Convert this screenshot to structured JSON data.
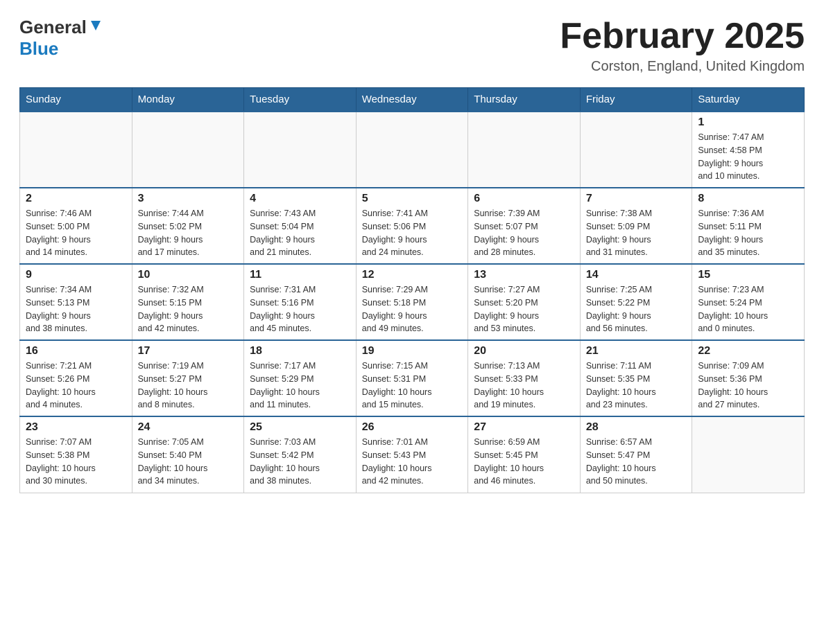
{
  "header": {
    "logo_general": "General",
    "logo_blue": "Blue",
    "month_title": "February 2025",
    "location": "Corston, England, United Kingdom"
  },
  "weekdays": [
    "Sunday",
    "Monday",
    "Tuesday",
    "Wednesday",
    "Thursday",
    "Friday",
    "Saturday"
  ],
  "weeks": [
    [
      {
        "day": "",
        "info": ""
      },
      {
        "day": "",
        "info": ""
      },
      {
        "day": "",
        "info": ""
      },
      {
        "day": "",
        "info": ""
      },
      {
        "day": "",
        "info": ""
      },
      {
        "day": "",
        "info": ""
      },
      {
        "day": "1",
        "info": "Sunrise: 7:47 AM\nSunset: 4:58 PM\nDaylight: 9 hours\nand 10 minutes."
      }
    ],
    [
      {
        "day": "2",
        "info": "Sunrise: 7:46 AM\nSunset: 5:00 PM\nDaylight: 9 hours\nand 14 minutes."
      },
      {
        "day": "3",
        "info": "Sunrise: 7:44 AM\nSunset: 5:02 PM\nDaylight: 9 hours\nand 17 minutes."
      },
      {
        "day": "4",
        "info": "Sunrise: 7:43 AM\nSunset: 5:04 PM\nDaylight: 9 hours\nand 21 minutes."
      },
      {
        "day": "5",
        "info": "Sunrise: 7:41 AM\nSunset: 5:06 PM\nDaylight: 9 hours\nand 24 minutes."
      },
      {
        "day": "6",
        "info": "Sunrise: 7:39 AM\nSunset: 5:07 PM\nDaylight: 9 hours\nand 28 minutes."
      },
      {
        "day": "7",
        "info": "Sunrise: 7:38 AM\nSunset: 5:09 PM\nDaylight: 9 hours\nand 31 minutes."
      },
      {
        "day": "8",
        "info": "Sunrise: 7:36 AM\nSunset: 5:11 PM\nDaylight: 9 hours\nand 35 minutes."
      }
    ],
    [
      {
        "day": "9",
        "info": "Sunrise: 7:34 AM\nSunset: 5:13 PM\nDaylight: 9 hours\nand 38 minutes."
      },
      {
        "day": "10",
        "info": "Sunrise: 7:32 AM\nSunset: 5:15 PM\nDaylight: 9 hours\nand 42 minutes."
      },
      {
        "day": "11",
        "info": "Sunrise: 7:31 AM\nSunset: 5:16 PM\nDaylight: 9 hours\nand 45 minutes."
      },
      {
        "day": "12",
        "info": "Sunrise: 7:29 AM\nSunset: 5:18 PM\nDaylight: 9 hours\nand 49 minutes."
      },
      {
        "day": "13",
        "info": "Sunrise: 7:27 AM\nSunset: 5:20 PM\nDaylight: 9 hours\nand 53 minutes."
      },
      {
        "day": "14",
        "info": "Sunrise: 7:25 AM\nSunset: 5:22 PM\nDaylight: 9 hours\nand 56 minutes."
      },
      {
        "day": "15",
        "info": "Sunrise: 7:23 AM\nSunset: 5:24 PM\nDaylight: 10 hours\nand 0 minutes."
      }
    ],
    [
      {
        "day": "16",
        "info": "Sunrise: 7:21 AM\nSunset: 5:26 PM\nDaylight: 10 hours\nand 4 minutes."
      },
      {
        "day": "17",
        "info": "Sunrise: 7:19 AM\nSunset: 5:27 PM\nDaylight: 10 hours\nand 8 minutes."
      },
      {
        "day": "18",
        "info": "Sunrise: 7:17 AM\nSunset: 5:29 PM\nDaylight: 10 hours\nand 11 minutes."
      },
      {
        "day": "19",
        "info": "Sunrise: 7:15 AM\nSunset: 5:31 PM\nDaylight: 10 hours\nand 15 minutes."
      },
      {
        "day": "20",
        "info": "Sunrise: 7:13 AM\nSunset: 5:33 PM\nDaylight: 10 hours\nand 19 minutes."
      },
      {
        "day": "21",
        "info": "Sunrise: 7:11 AM\nSunset: 5:35 PM\nDaylight: 10 hours\nand 23 minutes."
      },
      {
        "day": "22",
        "info": "Sunrise: 7:09 AM\nSunset: 5:36 PM\nDaylight: 10 hours\nand 27 minutes."
      }
    ],
    [
      {
        "day": "23",
        "info": "Sunrise: 7:07 AM\nSunset: 5:38 PM\nDaylight: 10 hours\nand 30 minutes."
      },
      {
        "day": "24",
        "info": "Sunrise: 7:05 AM\nSunset: 5:40 PM\nDaylight: 10 hours\nand 34 minutes."
      },
      {
        "day": "25",
        "info": "Sunrise: 7:03 AM\nSunset: 5:42 PM\nDaylight: 10 hours\nand 38 minutes."
      },
      {
        "day": "26",
        "info": "Sunrise: 7:01 AM\nSunset: 5:43 PM\nDaylight: 10 hours\nand 42 minutes."
      },
      {
        "day": "27",
        "info": "Sunrise: 6:59 AM\nSunset: 5:45 PM\nDaylight: 10 hours\nand 46 minutes."
      },
      {
        "day": "28",
        "info": "Sunrise: 6:57 AM\nSunset: 5:47 PM\nDaylight: 10 hours\nand 50 minutes."
      },
      {
        "day": "",
        "info": ""
      }
    ]
  ]
}
